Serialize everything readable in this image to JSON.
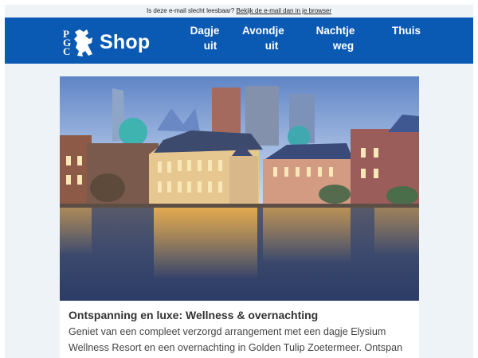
{
  "preheader": {
    "text": "Is deze e-mail slecht leesbaar?",
    "link": "Bekijk de e-mail dan in je browser"
  },
  "header": {
    "logo_letters": [
      "P",
      "G",
      "C"
    ],
    "brand": "Shop",
    "colors": {
      "bar": "#0a5ab3",
      "page_bg": "#eef3f8"
    },
    "nav": [
      {
        "line1": "Dagje",
        "line2": "uit"
      },
      {
        "line1": "Avondje",
        "line2": "uit"
      },
      {
        "line1": "Nachtje",
        "line2": "weg"
      },
      {
        "line1": "Thuis",
        "line2": ""
      }
    ]
  },
  "article": {
    "image_icon": "hague-skyline-photo",
    "title": "Ontspanning en luxe: Wellness & overnachting",
    "body": "Geniet van een compleet verzorgd arrangement met een dagje Elysium Wellness Resort en een overnachting in Golden Tulip Zoetermeer. Ontspan in de weldadige sauna's en laat je verwennen met een heerlijk ontbijt."
  }
}
